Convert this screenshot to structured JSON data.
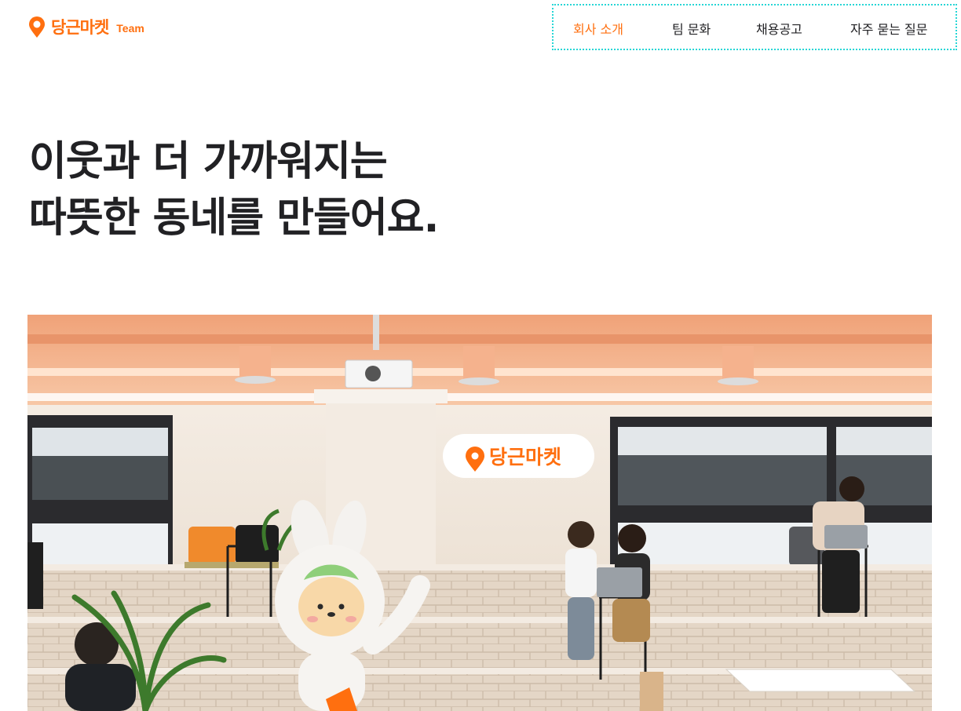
{
  "header": {
    "logo": {
      "brand_text": "당근마켓",
      "sub_text": "Team",
      "icon": "carrot-pin-icon"
    },
    "nav": {
      "items": [
        {
          "label": "회사 소개",
          "active": true
        },
        {
          "label": "팀 문화",
          "active": false
        },
        {
          "label": "채용공고",
          "active": false
        },
        {
          "label": "자주 묻는 질문",
          "active": false
        }
      ]
    }
  },
  "hero": {
    "headline_line1": "이웃과 더 가까워지는",
    "headline_line2": "따뜻한 동네를 만들어요."
  },
  "photo": {
    "sign_text": "당근마켓"
  },
  "colors": {
    "brand": "#ff6f0f",
    "text": "#212124",
    "focus_outline": "#27d6d6"
  }
}
